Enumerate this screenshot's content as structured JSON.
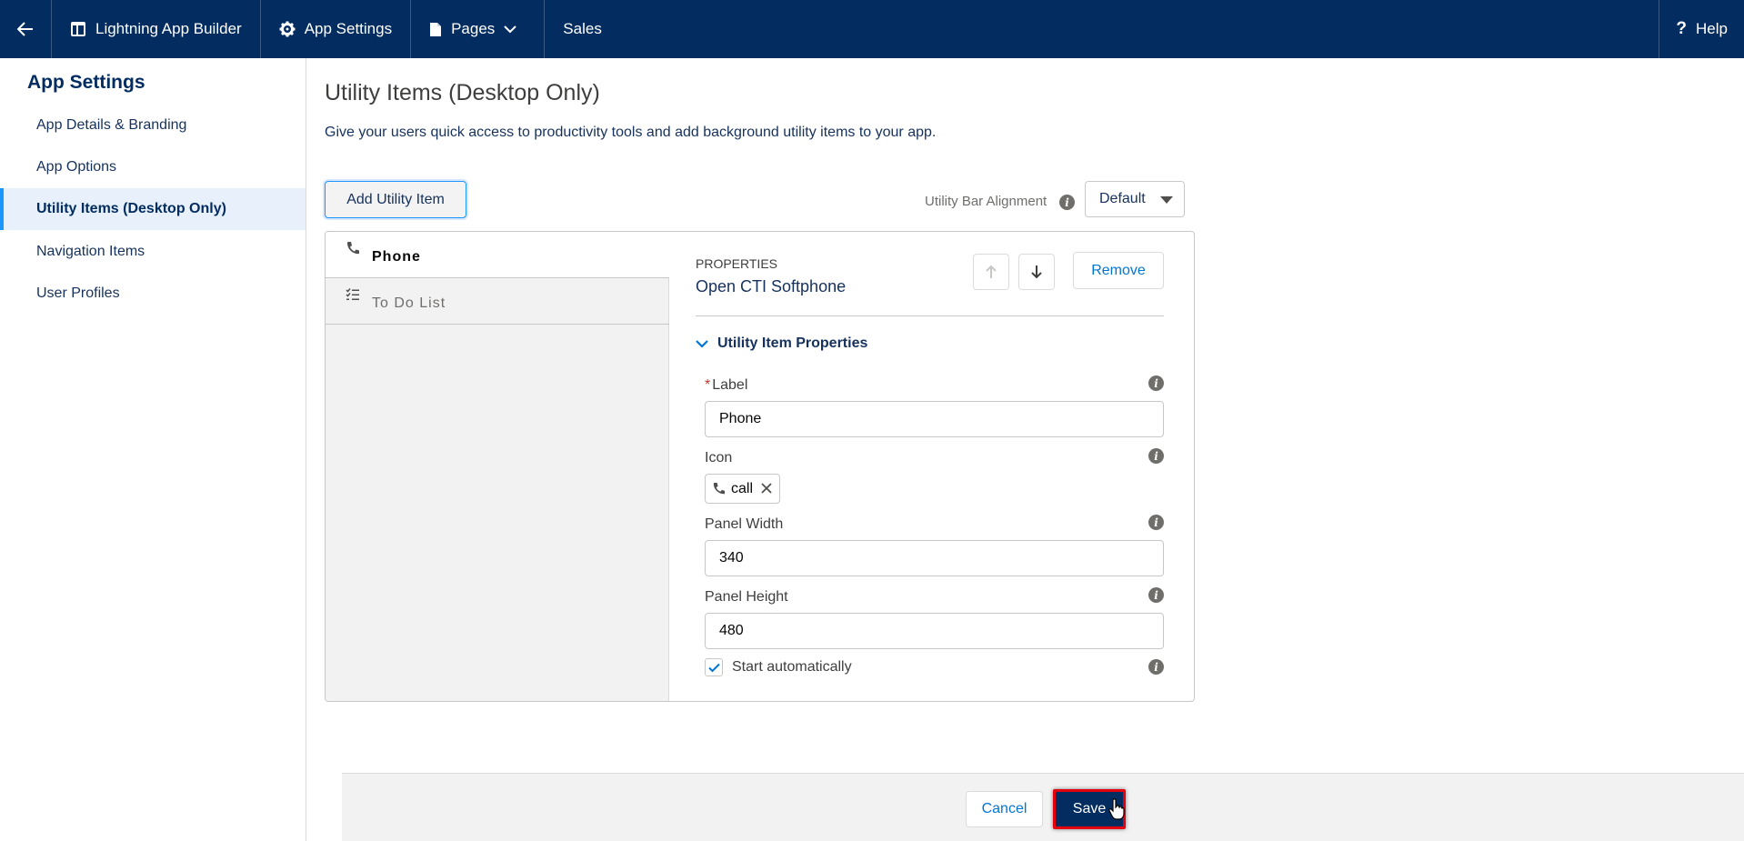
{
  "topbar": {
    "builder_label": "Lightning App Builder",
    "settings_label": "App Settings",
    "pages_label": "Pages",
    "app_name": "Sales",
    "help_label": "Help"
  },
  "sidebar": {
    "title": "App Settings",
    "items": [
      {
        "label": "App Details & Branding"
      },
      {
        "label": "App Options"
      },
      {
        "label": "Utility Items (Desktop Only)"
      },
      {
        "label": "Navigation Items"
      },
      {
        "label": "User Profiles"
      }
    ]
  },
  "main": {
    "title": "Utility Items (Desktop Only)",
    "description": "Give your users quick access to productivity tools and add background utility items to your app.",
    "add_button": "Add Utility Item",
    "alignment_label": "Utility Bar Alignment",
    "alignment_value": "Default"
  },
  "utility_items": [
    {
      "label": "Phone",
      "icon": "phone-icon"
    },
    {
      "label": "To Do List",
      "icon": "checklist-icon"
    }
  ],
  "properties": {
    "caption": "PROPERTIES",
    "component_name": "Open CTI Softphone",
    "remove_label": "Remove",
    "section_title": "Utility Item Properties",
    "label_field": {
      "label": "Label",
      "required_mark": "*",
      "value": "Phone"
    },
    "icon_field": {
      "label": "Icon",
      "value": "call"
    },
    "panel_width": {
      "label": "Panel Width",
      "value": "340"
    },
    "panel_height": {
      "label": "Panel Height",
      "value": "480"
    },
    "start_auto": {
      "label": "Start automatically",
      "checked": true
    }
  },
  "footer": {
    "cancel_label": "Cancel",
    "save_label": "Save"
  },
  "colors": {
    "header": "#032d60",
    "accent": "#1b96ff",
    "link": "#0176d3",
    "highlight": "#e3000f"
  }
}
